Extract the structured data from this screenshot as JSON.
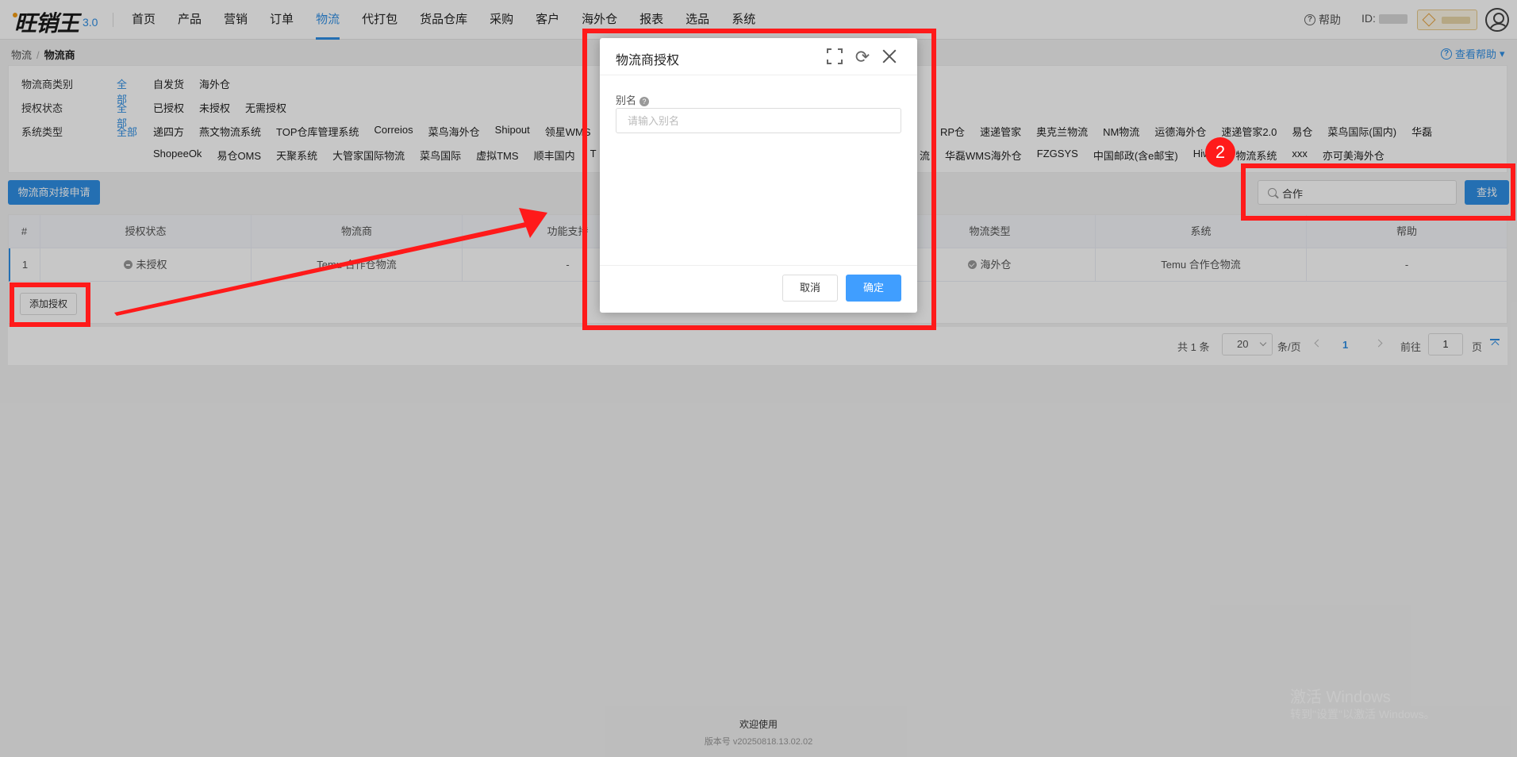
{
  "app": {
    "logo_text": "旺销王",
    "version": "3.0"
  },
  "nav": {
    "items": [
      "首页",
      "产品",
      "营销",
      "订单",
      "物流",
      "代打包",
      "货品仓库",
      "采购",
      "客户",
      "海外仓",
      "报表",
      "选品",
      "系统"
    ],
    "active": "物流",
    "help": "帮助",
    "id_label": "ID:"
  },
  "breadcrumb": {
    "parent": "物流",
    "separator": "/",
    "current": "物流商",
    "view_help": "查看帮助"
  },
  "filters": {
    "all_label": "全部",
    "rows": [
      {
        "label": "物流商类别",
        "options": [
          "自发货",
          "海外仓"
        ]
      },
      {
        "label": "授权状态",
        "options": [
          "已授权",
          "未授权",
          "无需授权"
        ]
      },
      {
        "label": "系统类型",
        "line1": [
          "递四方",
          "燕文物流系统",
          "TOP仓库管理系统",
          "Correios",
          "菜鸟海外仓",
          "Shipout",
          "领星WMS"
        ],
        "line1_right": [
          "RP仓",
          "速递管家",
          "奥克兰物流",
          "NM物流",
          "运德海外仓",
          "速递管家2.0",
          "易仓",
          "菜鸟国际(国内)",
          "华磊"
        ],
        "line2": [
          "ShopeeOk",
          "易仓OMS",
          "天聚系统",
          "大管家国际物流",
          "菜鸟国际",
          "虚拟TMS",
          "顺丰国内",
          "T"
        ],
        "line2_right": [
          "流",
          "华磊WMS海外仓",
          "FZGSYS",
          "中国邮政(含e邮宝)",
          "Hiw",
          "物流系统",
          "xxx",
          "亦可美海外仓"
        ]
      }
    ]
  },
  "toolbar": {
    "apply_button": "物流商对接申请",
    "search_value": "合作",
    "search_button": "查找"
  },
  "table": {
    "headers": [
      "#",
      "授权状态",
      "物流商",
      "功能支持",
      "物流类型",
      "系统",
      "帮助"
    ],
    "rows": [
      {
        "index": "1",
        "auth_status": "未授权",
        "provider": "Temu 合作仓物流",
        "features": "-",
        "logistics_type": "海外仓",
        "system": "Temu 合作仓物流",
        "help": "-"
      }
    ],
    "add_auth_button": "添加授权"
  },
  "pagination": {
    "total": "共 1 条",
    "page_size": "20",
    "per_page": "条/页",
    "current": "1",
    "goto": "前往",
    "goto_value": "1",
    "page_unit": "页"
  },
  "footer": {
    "welcome": "欢迎使用",
    "version": "版本号 v20250818.13.02.02"
  },
  "watermark": {
    "line1": "激活 Windows",
    "line2": "转到\"设置\"以激活 Windows。"
  },
  "modal": {
    "title": "物流商授权",
    "field_label": "别名",
    "field_placeholder": "请输入别名",
    "cancel": "取消",
    "confirm": "确定"
  },
  "annotation": {
    "step_badge": "2",
    "color": "#ff1a1a"
  }
}
